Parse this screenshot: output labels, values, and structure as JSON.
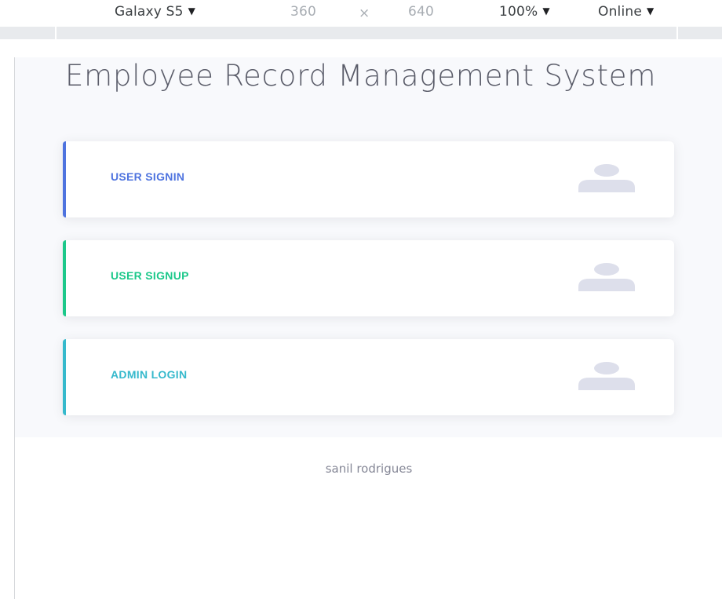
{
  "devtools": {
    "device": "Galaxy S5",
    "width": "360",
    "times": "×",
    "height": "640",
    "zoom": "100%",
    "network": "Online",
    "caret": "▼"
  },
  "page": {
    "title": "Employee Record Management System",
    "cards": [
      {
        "label": "USER SIGNIN",
        "color": "#4e73df",
        "icon": "user-icon"
      },
      {
        "label": "USER SIGNUP",
        "color": "#1cc88a",
        "icon": "user-icon"
      },
      {
        "label": "ADMIN LOGIN",
        "color": "#36b9cc",
        "icon": "user-icon"
      }
    ],
    "footer": "sanil rodrigues",
    "icon_color": "#dddfeb"
  }
}
